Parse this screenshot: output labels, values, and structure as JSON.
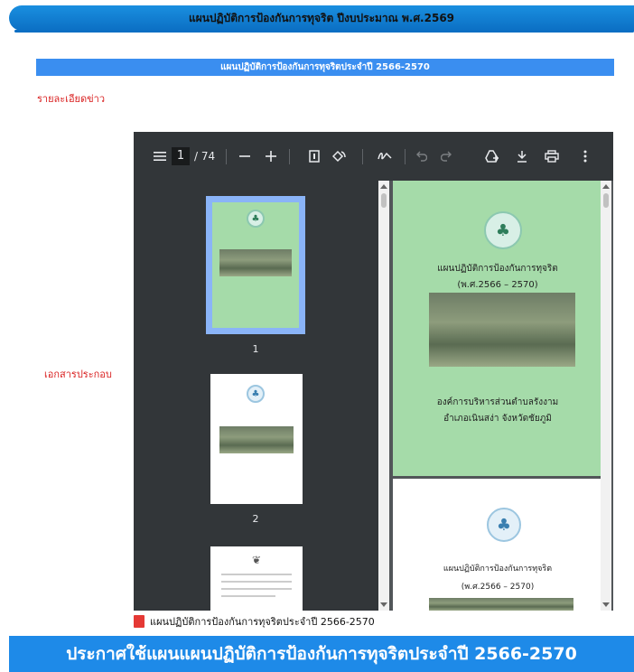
{
  "top_banner": {
    "title": "แผนปฏิบัติการป้องกันการทุจริต ปีงบประมาณ พ.ศ.2569"
  },
  "section": {
    "title": "แผนปฏิบัติการป้องกันการทุจริตประจำปี 2566-2570"
  },
  "labels": {
    "news_detail": "รายละเอียดข่าว",
    "attachments": "เอกสารประกอบ"
  },
  "pdf": {
    "current_page": "1",
    "total_pages": "/ 74",
    "thumbnails": [
      {
        "label": "1"
      },
      {
        "label": "2"
      }
    ],
    "page1": {
      "title": "แผนปฏิบัติการป้องกันการทุจริต",
      "years": "(พ.ศ.2566 – 2570)",
      "org": "องค์การบริหารส่วนตำบลรังงาม",
      "district": "อำเภอเนินสง่า  จังหวัดชัยภูมิ"
    },
    "page2": {
      "title": "แผนปฏิบัติการป้องกันการทุจริต",
      "years": "(พ.ศ.2566 – 2570)"
    },
    "icons": [
      "menu-icon",
      "zoom-out-icon",
      "zoom-in-icon",
      "fit-page-icon",
      "rotate-icon",
      "draw-icon",
      "undo-icon",
      "redo-icon",
      "add-drive-icon",
      "download-icon",
      "print-icon",
      "more-icon"
    ]
  },
  "file": {
    "name": "แผนปฏิบัติการป้องกันการทุจริตประจำปี 2566-2570"
  },
  "bottom_bar": {
    "title": "ประกาศใช้แผนแผนปฏิบัติการป้องกันการทุจริตประจำปี 2566-2570"
  }
}
